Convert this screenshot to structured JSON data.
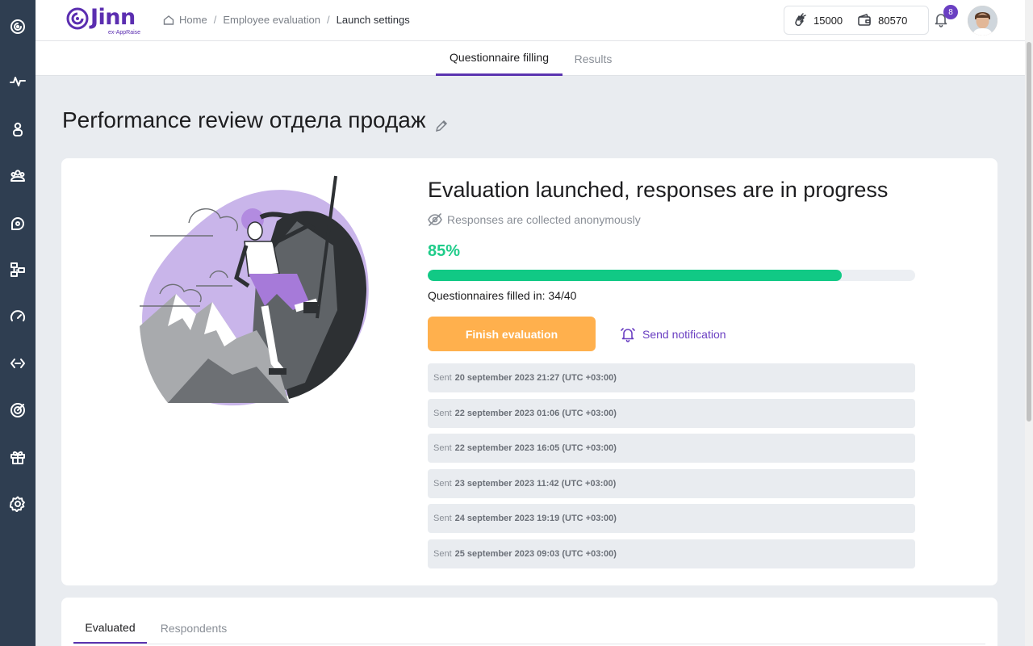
{
  "brand": {
    "logo_text": "Jinn",
    "logo_subtext": "ex-AppRaise",
    "accent_color": "#5b34b0",
    "success_color": "#11c985",
    "warning_color": "#ffb04d"
  },
  "sidebar": {
    "icons": [
      "logo-swirl-icon",
      "pulse-icon",
      "user-icon",
      "team-icon",
      "feedback-icon",
      "org-structure-icon",
      "gauge-icon",
      "exchange-icon",
      "target-icon",
      "gift-icon",
      "settings-icon"
    ]
  },
  "breadcrumb": {
    "items": [
      "Home",
      "Employee evaluation",
      "Launch settings"
    ]
  },
  "wallet": {
    "claps": "15000",
    "balance": "80570"
  },
  "notifications": {
    "count": "8"
  },
  "top_tabs": {
    "questionnaire": "Questionnaire filling",
    "results": "Results"
  },
  "page": {
    "title": "Performance review отдела продаж"
  },
  "status": {
    "title": "Evaluation launched, responses are in progress",
    "anonymous": "Responses are collected anonymously",
    "percent_label": "85%",
    "progress_fraction": 0.85,
    "filled_text": "Questionnaires filled in: 34/40",
    "finish_button": "Finish evaluation",
    "notify_button": "Send notification"
  },
  "sent": {
    "prefix": "Sent",
    "items": [
      "20 september 2023 21:27 (UTC +03:00)",
      "22 september 2023 01:06 (UTC +03:00)",
      "22 september 2023 16:05 (UTC +03:00)",
      "23 september 2023 11:42 (UTC +03:00)",
      "24 september 2023 19:19 (UTC +03:00)",
      "25 september 2023 09:03 (UTC +03:00)"
    ]
  },
  "bottom_tabs": {
    "evaluated": "Evaluated",
    "respondents": "Respondents"
  }
}
